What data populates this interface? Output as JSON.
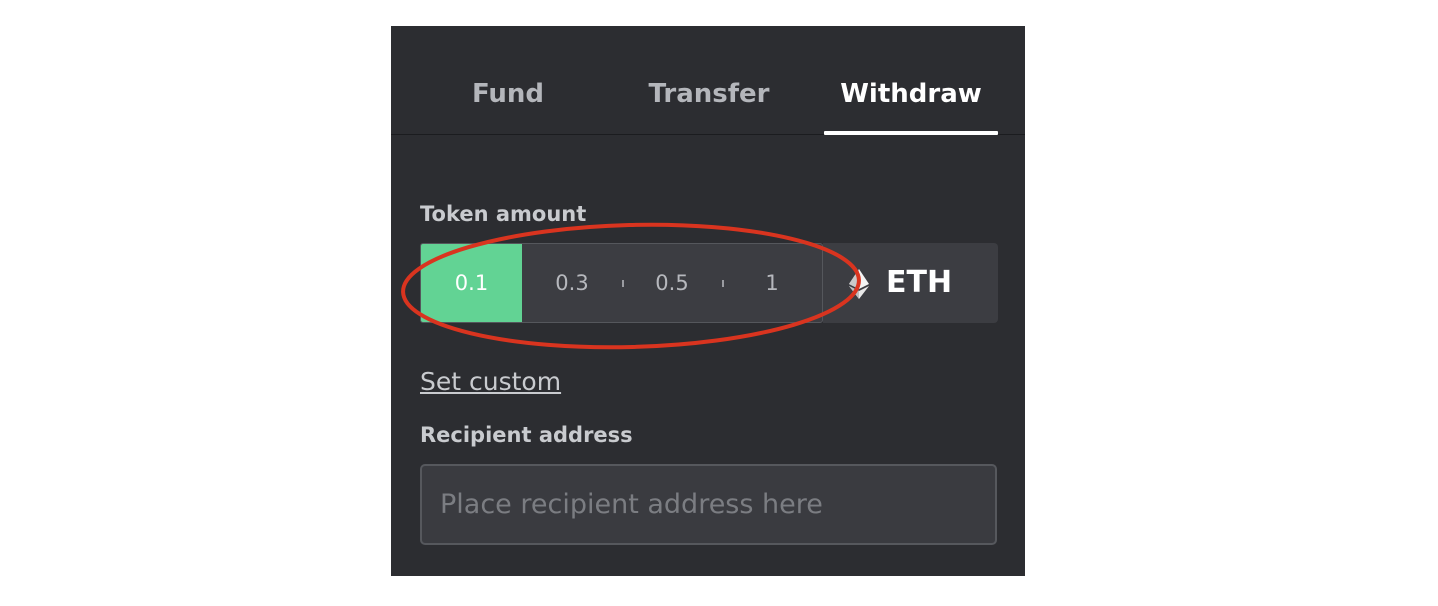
{
  "tabs": [
    {
      "label": "Fund",
      "active": false
    },
    {
      "label": "Transfer",
      "active": false
    },
    {
      "label": "Withdraw",
      "active": true
    }
  ],
  "token_amount": {
    "label": "Token amount",
    "options": [
      "0.1",
      "0.3",
      "0.5",
      "1"
    ],
    "selected": "0.1",
    "token": "ETH",
    "token_icon": "ethereum-icon"
  },
  "set_custom_label": "Set custom",
  "recipient": {
    "label": "Recipient address",
    "value": "",
    "placeholder": "Place recipient address here"
  },
  "colors": {
    "panel_bg": "#2c2d31",
    "selected_option": "#62d394",
    "highlight_annotation": "#d9341f"
  }
}
